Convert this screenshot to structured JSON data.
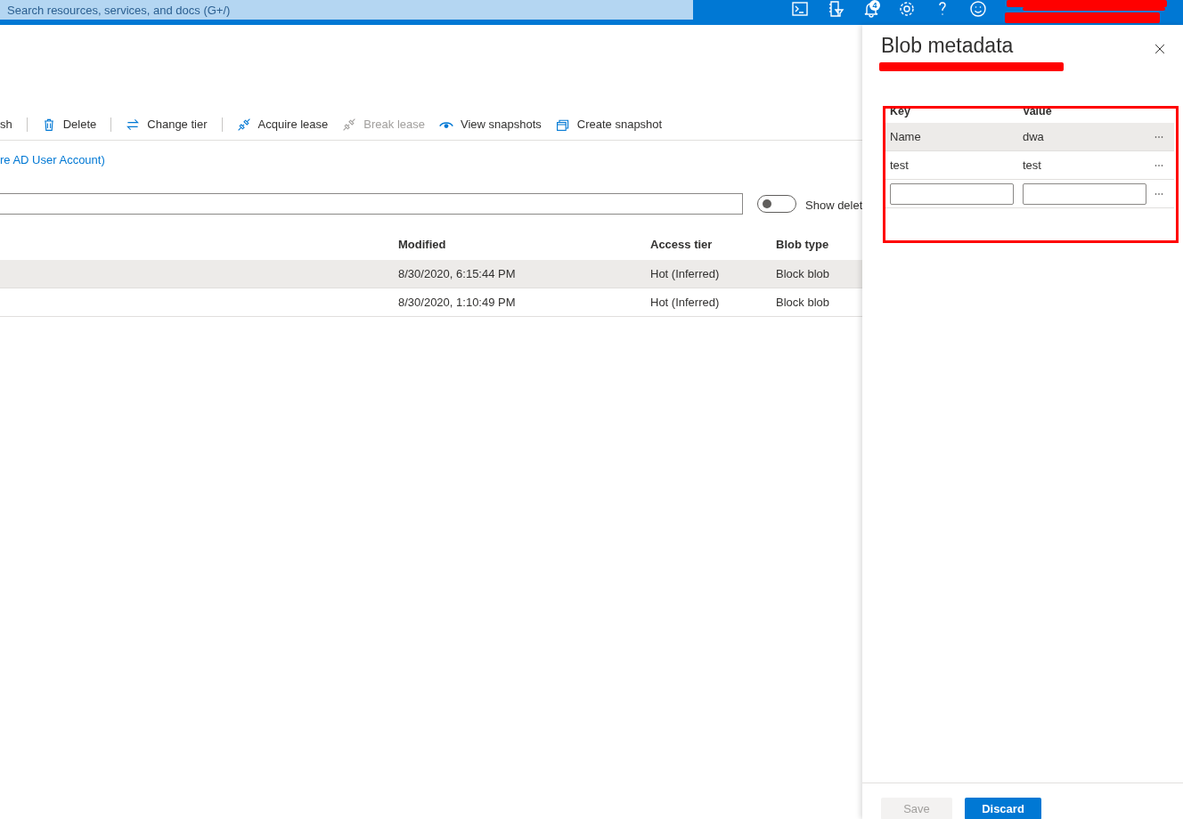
{
  "header": {
    "search_placeholder": "Search resources, services, and docs (G+/)",
    "notification_count": "4"
  },
  "toolbar": [
    {
      "label": "sh",
      "kind": "text",
      "disabled": false
    },
    {
      "kind": "separator"
    },
    {
      "label": "Delete",
      "kind": "trash",
      "disabled": false
    },
    {
      "kind": "separator"
    },
    {
      "label": "Change tier",
      "kind": "swap",
      "disabled": false
    },
    {
      "kind": "separator"
    },
    {
      "label": "Acquire lease",
      "kind": "plug",
      "disabled": false
    },
    {
      "label": "Break lease",
      "kind": "plug",
      "disabled": true
    },
    {
      "label": "View snapshots",
      "kind": "eye",
      "disabled": false
    },
    {
      "label": "Create snapshot",
      "kind": "stack",
      "disabled": false
    }
  ],
  "auth_link": "re AD User Account)",
  "filter": {
    "toggle_on": false,
    "toggle_label": "Show delet"
  },
  "blob_table": {
    "columns": [
      "Modified",
      "Access tier",
      "Blob type"
    ],
    "rows": [
      {
        "cells": [
          "8/30/2020, 6:15:44 PM",
          "Hot (Inferred)",
          "Block blob"
        ],
        "selected": true
      },
      {
        "cells": [
          "8/30/2020, 1:10:49 PM",
          "Hot (Inferred)",
          "Block blob"
        ],
        "selected": false
      }
    ]
  },
  "panel": {
    "title": "Blob metadata",
    "columns": [
      "Key",
      "Value"
    ],
    "rows": [
      {
        "key": "Name",
        "value": "dwa",
        "selected": true
      },
      {
        "key": "test",
        "value": "test",
        "selected": false
      }
    ],
    "buttons": [
      {
        "label": "Save",
        "kind": "secondary",
        "disabled": true
      },
      {
        "label": "Discard",
        "kind": "primary",
        "disabled": false
      }
    ]
  }
}
